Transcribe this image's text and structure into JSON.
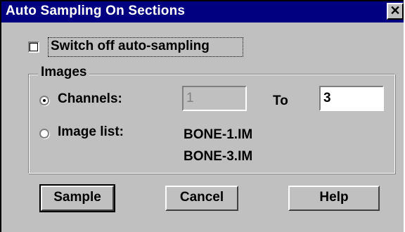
{
  "window": {
    "title": "Auto Sampling On Sections",
    "close_glyph": "✕"
  },
  "switch_off": {
    "label": "Switch off auto-sampling",
    "checked": false
  },
  "images_group": {
    "legend": "Images",
    "channels_label": "Channels:",
    "channels_selected": true,
    "from_value": "1",
    "to_label": "To",
    "to_value": "3",
    "image_list_label": "Image list:",
    "image_list_selected": false,
    "image_list": [
      "BONE-1.IM",
      "BONE-3.IM"
    ]
  },
  "buttons": {
    "sample": "Sample",
    "cancel": "Cancel",
    "help": "Help"
  },
  "colors": {
    "titlebar": "#000080",
    "face": "#c0c0c0"
  }
}
